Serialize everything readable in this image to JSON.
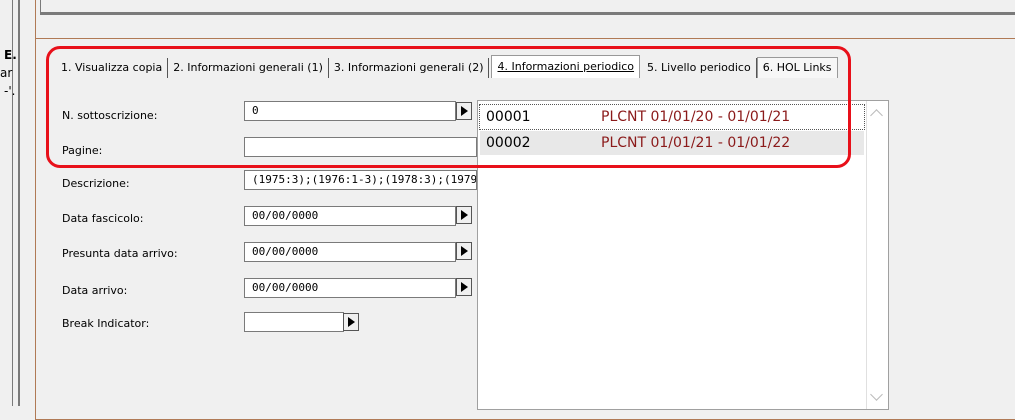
{
  "left_edge": {
    "text1": "E.",
    "text2": "ar",
    "text3": "-'."
  },
  "tabs": [
    {
      "label": "1. Visualizza copia"
    },
    {
      "label": "2. Informazioni generali (1)"
    },
    {
      "label": "3. Informazioni generali (2)"
    },
    {
      "label": "4. Informazioni periodico"
    },
    {
      "label": "5. Livello periodico"
    },
    {
      "label": "6. HOL Links"
    }
  ],
  "form": {
    "sottoscrizione": {
      "label": "N. sottoscrizione:",
      "value": "0"
    },
    "pagine": {
      "label": "Pagine:",
      "value": ""
    },
    "descrizione": {
      "label": "Descrizione:",
      "value": "(1975:3);(1976:1-3);(1978:3);(1979"
    },
    "data_fascicolo": {
      "label": "Data fascicolo:",
      "value": "00/00/0000"
    },
    "presunta_data": {
      "label": "Presunta data arrivo:",
      "value": "00/00/0000"
    },
    "data_arrivo": {
      "label": "Data arrivo:",
      "value": "00/00/0000"
    },
    "break_indicator": {
      "label": "Break Indicator:",
      "value": ""
    }
  },
  "dropdown": {
    "items": [
      {
        "code": "00001",
        "desc": "PLCNT 01/01/20 - 01/01/21"
      },
      {
        "code": "00002",
        "desc": "PLCNT 01/01/21 - 01/01/22"
      }
    ]
  },
  "colors": {
    "highlight": "#e8101a",
    "desc_text": "#8b1a1a",
    "panel_border": "#b07a55"
  }
}
